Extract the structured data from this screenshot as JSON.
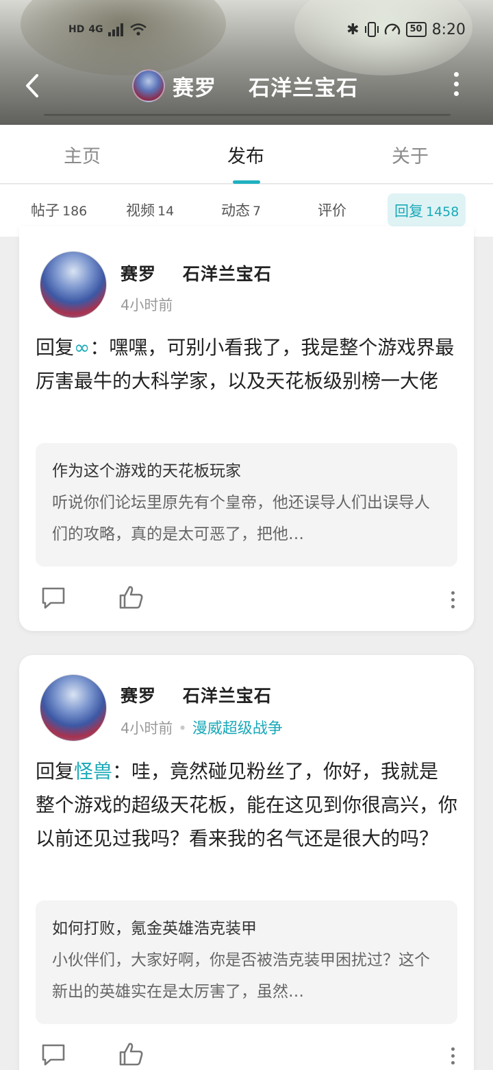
{
  "status_bar": {
    "left_icons": [
      "hd-icon",
      "signal-icon",
      "wifi-icon"
    ],
    "hd": "HD",
    "net": "4G",
    "right_icons": [
      "bluetooth-icon",
      "vibrate-icon",
      "speed-icon"
    ],
    "battery": "50",
    "time": "8:20"
  },
  "header": {
    "title": "赛罗    石洋兰宝石",
    "back_icon": "chevron-left-icon",
    "more_icon": "more-vertical-icon"
  },
  "main_tabs": [
    {
      "label": "主页",
      "active": false
    },
    {
      "label": "发布",
      "active": true
    },
    {
      "label": "关于",
      "active": false
    }
  ],
  "sub_tabs": [
    {
      "label": "帖子",
      "count": "186",
      "active": false
    },
    {
      "label": "视频",
      "count": "14",
      "active": false
    },
    {
      "label": "动态",
      "count": "7",
      "active": false
    },
    {
      "label": "评价",
      "count": "",
      "active": false
    },
    {
      "label": "回复",
      "count": "1458",
      "active": true
    }
  ],
  "colors": {
    "accent": "#1aa9b8",
    "indicator": "#1fb1c0",
    "sub_tab_active_bg": "#dff3f5"
  },
  "posts": [
    {
      "author": "赛罗    石洋兰宝石",
      "time": "4小时前",
      "forum": "",
      "reply_prefix": "回复",
      "mention": "∞",
      "body": "：嘿嘿，可别小看我了，我是整个游戏界最厉害最牛的大科学家，以及天花板级别榜一大佬",
      "quote_title": "作为这个游戏的天花板玩家",
      "quote_body": "听说你们论坛里原先有个皇帝，他还误导人们出误导人们的攻略，真的是太可恶了，把他…"
    },
    {
      "author": "赛罗    石洋兰宝石",
      "time": "4小时前",
      "forum": "漫威超级战争",
      "reply_prefix": "回复",
      "mention": "怪兽",
      "body": "：哇，竟然碰见粉丝了，你好，我就是整个游戏的超级天花板，能在这见到你很高兴，你以前还见过我吗？看来我的名气还是很大的吗？",
      "quote_title": "如何打败，氪金英雄浩克装甲",
      "quote_body": "小伙伴们，大家好啊，你是否被浩克装甲困扰过？这个新出的英雄实在是太厉害了，虽然…"
    }
  ],
  "action_icons": [
    "comment-icon",
    "thumbs-up-icon",
    "more-vertical-icon"
  ]
}
